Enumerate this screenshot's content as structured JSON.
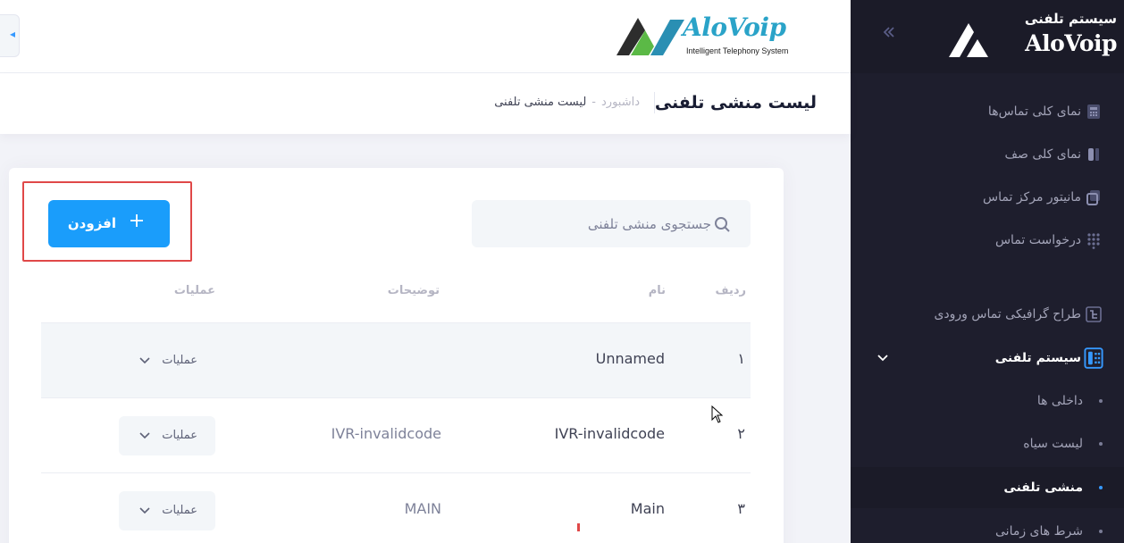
{
  "sidebar": {
    "logo_top": "سیستم تلفنی",
    "logo_main": "AloVoip",
    "toggle_icon": "double-chevron-left-icon",
    "items": [
      {
        "label": "نمای کلی تماس‌ها",
        "icon": "call-overview-icon"
      },
      {
        "label": "نمای کلی صف",
        "icon": "queue-icon"
      },
      {
        "label": "مانیتور مرکز تماس",
        "icon": "monitor-icon"
      },
      {
        "label": "درخواست تماس",
        "icon": "dialpad-icon"
      },
      {
        "label": "طراح گرافیکی تماس ورودی",
        "icon": "flow-designer-icon"
      },
      {
        "label": "سیستم تلفنی",
        "icon": "telephone-icon",
        "expanded": true
      }
    ],
    "subitems": [
      {
        "label": "داخلی ها"
      },
      {
        "label": "لیست سیاه"
      },
      {
        "label": "منشی تلفنی",
        "active": true
      },
      {
        "label": "شرط های زمانی"
      }
    ]
  },
  "header": {
    "logo_main": "AloVoip",
    "logo_sub": "Intelligent Telephony System",
    "brand_colors": {
      "green": "#5bb946",
      "blue": "#2a8fb3",
      "dark": "#2d2d2d"
    }
  },
  "subheader": {
    "title": "لیست منشی تلفنی",
    "breadcrumb_home": "داشبورد",
    "breadcrumb_separator": "-",
    "breadcrumb_current": "لیست منشی تلفنی"
  },
  "toolbar": {
    "search_placeholder": "جستجوی منشی تلفنی",
    "add_label": "افزودن"
  },
  "table": {
    "columns": [
      "ردیف",
      "نام",
      "توضیحات",
      "عملیات"
    ],
    "rows": [
      {
        "index": "۱",
        "name": "Unnamed",
        "description": "",
        "ops": "عملیات"
      },
      {
        "index": "۲",
        "name": "IVR-invalidcode",
        "description": "IVR-invalidcode",
        "ops": "عملیات"
      },
      {
        "index": "۳",
        "name": "Main",
        "description": "MAIN",
        "ops": "عملیات"
      }
    ]
  },
  "colors": {
    "sidebar_bg": "#1e1e2d",
    "primary": "#1a9dfb",
    "highlight": "#e04848"
  }
}
